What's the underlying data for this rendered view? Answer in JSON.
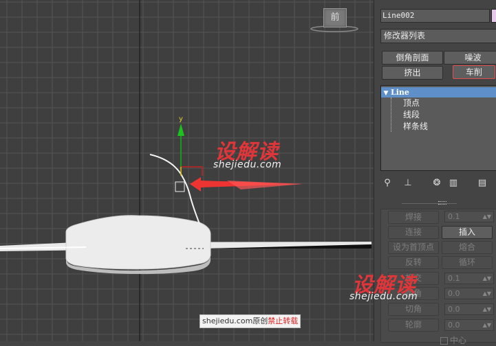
{
  "viewport": {
    "viewcube_label": "前",
    "axis_y_label": "y",
    "watermark_logo": "设解读",
    "watermark_url": "shejiedu.com",
    "bottom_watermark": {
      "site": "shejiedu.com原创",
      "note": "禁止转载"
    }
  },
  "panel": {
    "object_name": "Line002",
    "object_color": "#e4c9ea",
    "modifier_list": "修改器列表",
    "modifier_buttons": [
      "倒角剖面",
      "噪波",
      "挤出",
      "车削"
    ],
    "highlight_color": "#e05050",
    "stack": {
      "line_label": "Line",
      "sub_items": [
        "顶点",
        "线段",
        "样条线"
      ]
    },
    "tool_icons": [
      "pin-icon",
      "show-end-result-icon",
      "make-unique-icon",
      "remove-modifier-icon",
      "configure-modifier-sets-icon"
    ],
    "geometry": {
      "buttons": {
        "weld": "焊接",
        "connect": "连接",
        "insert": "插入",
        "make_first": "设为首顶点",
        "fuse": "熔合",
        "reverse": "反转",
        "cycle": "循环",
        "crossinsert": "相交",
        "fillet": "圆角",
        "chamfer": "切角",
        "outline": "轮廓"
      },
      "values": {
        "weld": "0.1",
        "crossinsert": "0.1",
        "fillet": "0.0",
        "chamfer": "0.0",
        "outline": "0.0"
      },
      "center_label": "中心"
    }
  }
}
